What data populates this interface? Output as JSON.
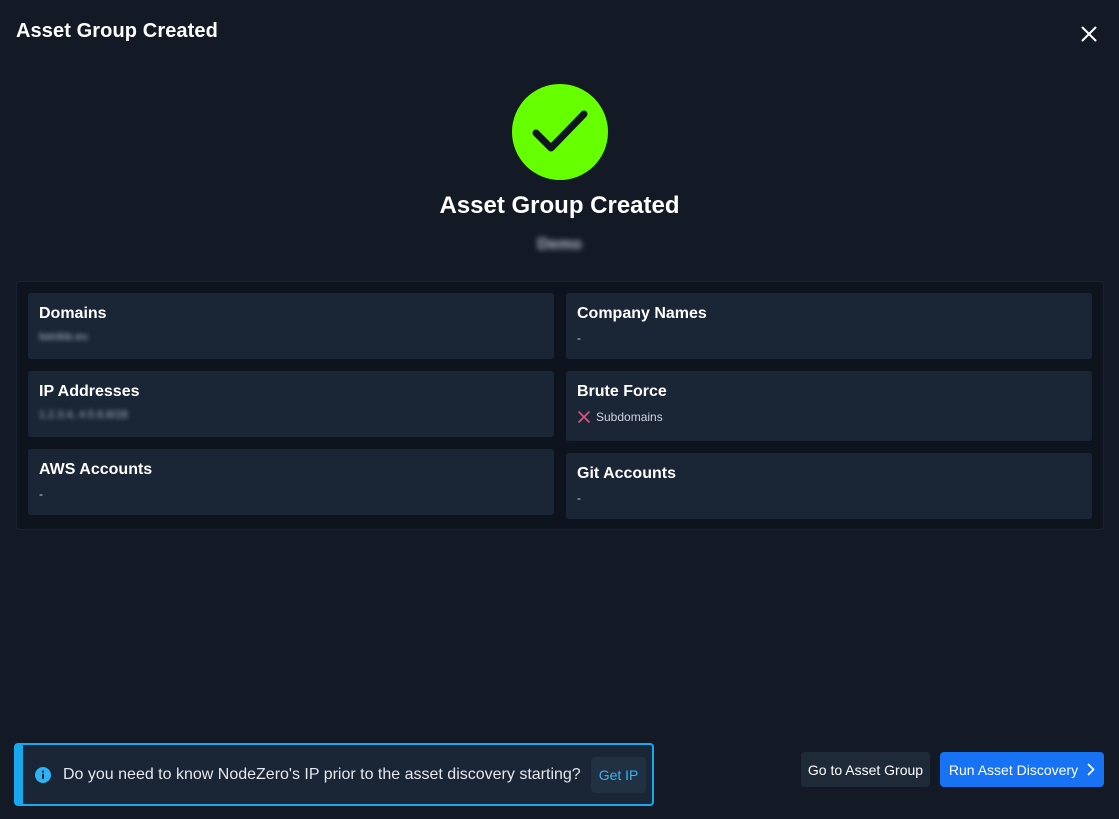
{
  "modal": {
    "title": "Asset Group Created"
  },
  "success": {
    "title": "Asset Group Created",
    "group_name": "Demo",
    "icon": "check-icon",
    "color": "#66ff00"
  },
  "summary": {
    "domains": {
      "label": "Domains",
      "value": "twinkle.eu"
    },
    "ip_addresses": {
      "label": "IP Addresses",
      "value": "1.2.3.4, 4.5.6.8/28"
    },
    "aws_accounts": {
      "label": "AWS Accounts",
      "value": "-"
    },
    "company_names": {
      "label": "Company Names",
      "value": "-"
    },
    "brute_force": {
      "label": "Brute Force",
      "value": "Subdomains",
      "status_icon": "x-icon",
      "status_color": "#e0567a"
    },
    "git_accounts": {
      "label": "Git Accounts",
      "value": "-"
    }
  },
  "banner": {
    "icon": "info-icon",
    "text": "Do you need to know NodeZero's IP prior to the asset discovery starting?",
    "button_label": "Get IP"
  },
  "actions": {
    "secondary_label": "Go to Asset Group",
    "primary_label": "Run Asset Discovery"
  },
  "colors": {
    "background": "#131a25",
    "card": "#1a2536",
    "accent": "#1772f4",
    "info": "#18a8f0"
  }
}
